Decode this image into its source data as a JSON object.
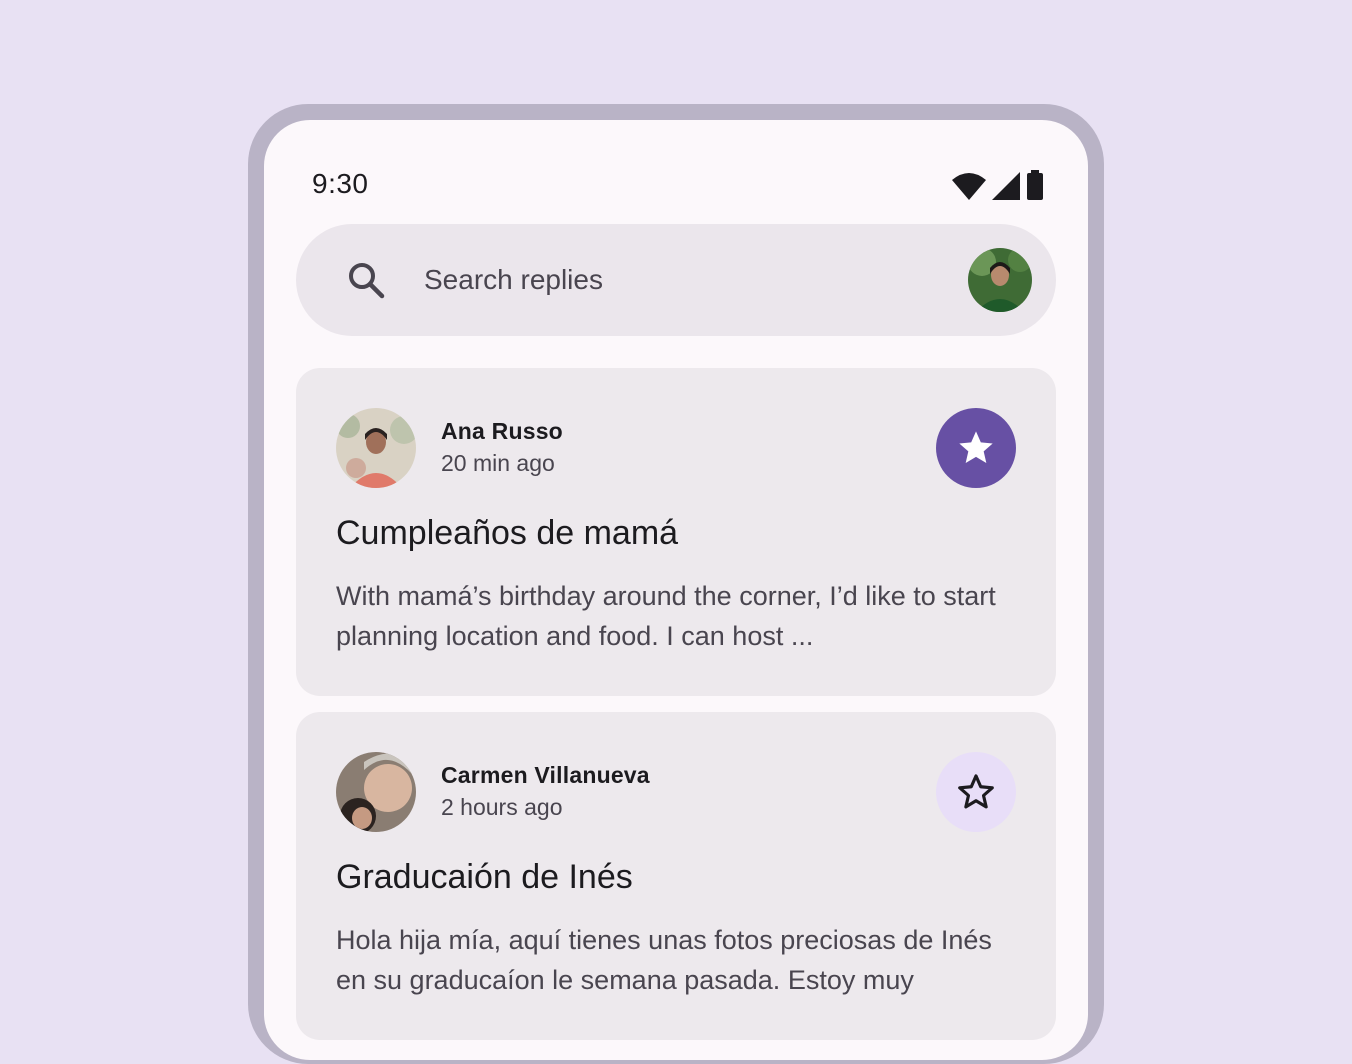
{
  "status_bar": {
    "time": "9:30",
    "icons": [
      "wifi-icon",
      "signal-icon",
      "battery-icon"
    ]
  },
  "search": {
    "placeholder": "Search replies",
    "icon": "search-icon"
  },
  "emails": [
    {
      "sender": "Ana Russo",
      "time": "20 min ago",
      "subject": "Cumpleaños de mamá",
      "preview": "With mamá’s birthday around the corner, I’d like to start planning location and food. I can host ...",
      "starred": true
    },
    {
      "sender": "Carmen Villanueva",
      "time": "2 hours ago",
      "subject": "Graducaión de Inés",
      "preview": "Hola hija mía, aquí tienes unas fotos preciosas de Inés en su graducaíon le semana pasada. Estoy muy",
      "starred": false
    }
  ],
  "colors": {
    "background": "#e8e1f3",
    "frame": "#b9b3c6",
    "surface": "#fcf8fb",
    "card": "#ede9ed",
    "accent": "#6750a4",
    "accent_container": "#e8def8"
  }
}
